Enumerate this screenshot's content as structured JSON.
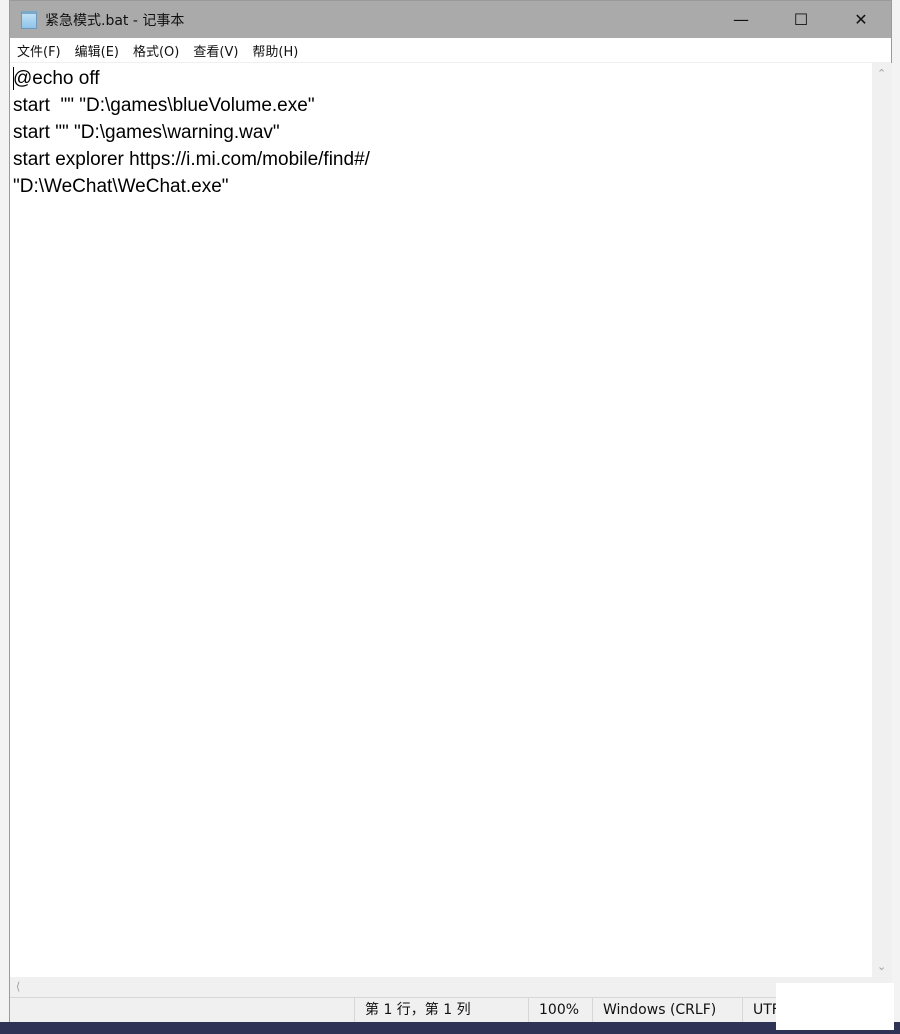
{
  "window": {
    "title": "紧急模式.bat - 记事本",
    "controls": {
      "minimize": "—",
      "maximize": "☐",
      "close": "✕"
    }
  },
  "menu": [
    "文件(F)",
    "编辑(E)",
    "格式(O)",
    "查看(V)",
    "帮助(H)"
  ],
  "editor": {
    "lines": [
      "@echo off",
      "start  \"\" \"D:\\games\\blueVolume.exe\"",
      "start \"\" \"D:\\games\\warning.wav\"",
      "start explorer https://i.mi.com/mobile/find#/",
      "\"D:\\WeChat\\WeChat.exe\""
    ]
  },
  "status": {
    "position": "第 1 行，第 1 列",
    "zoom": "100%",
    "line_ending": "Windows (CRLF)",
    "encoding": "UTF"
  },
  "colors": {
    "titlebar": "#aaaaaa",
    "taskbar": "#2f3457"
  }
}
